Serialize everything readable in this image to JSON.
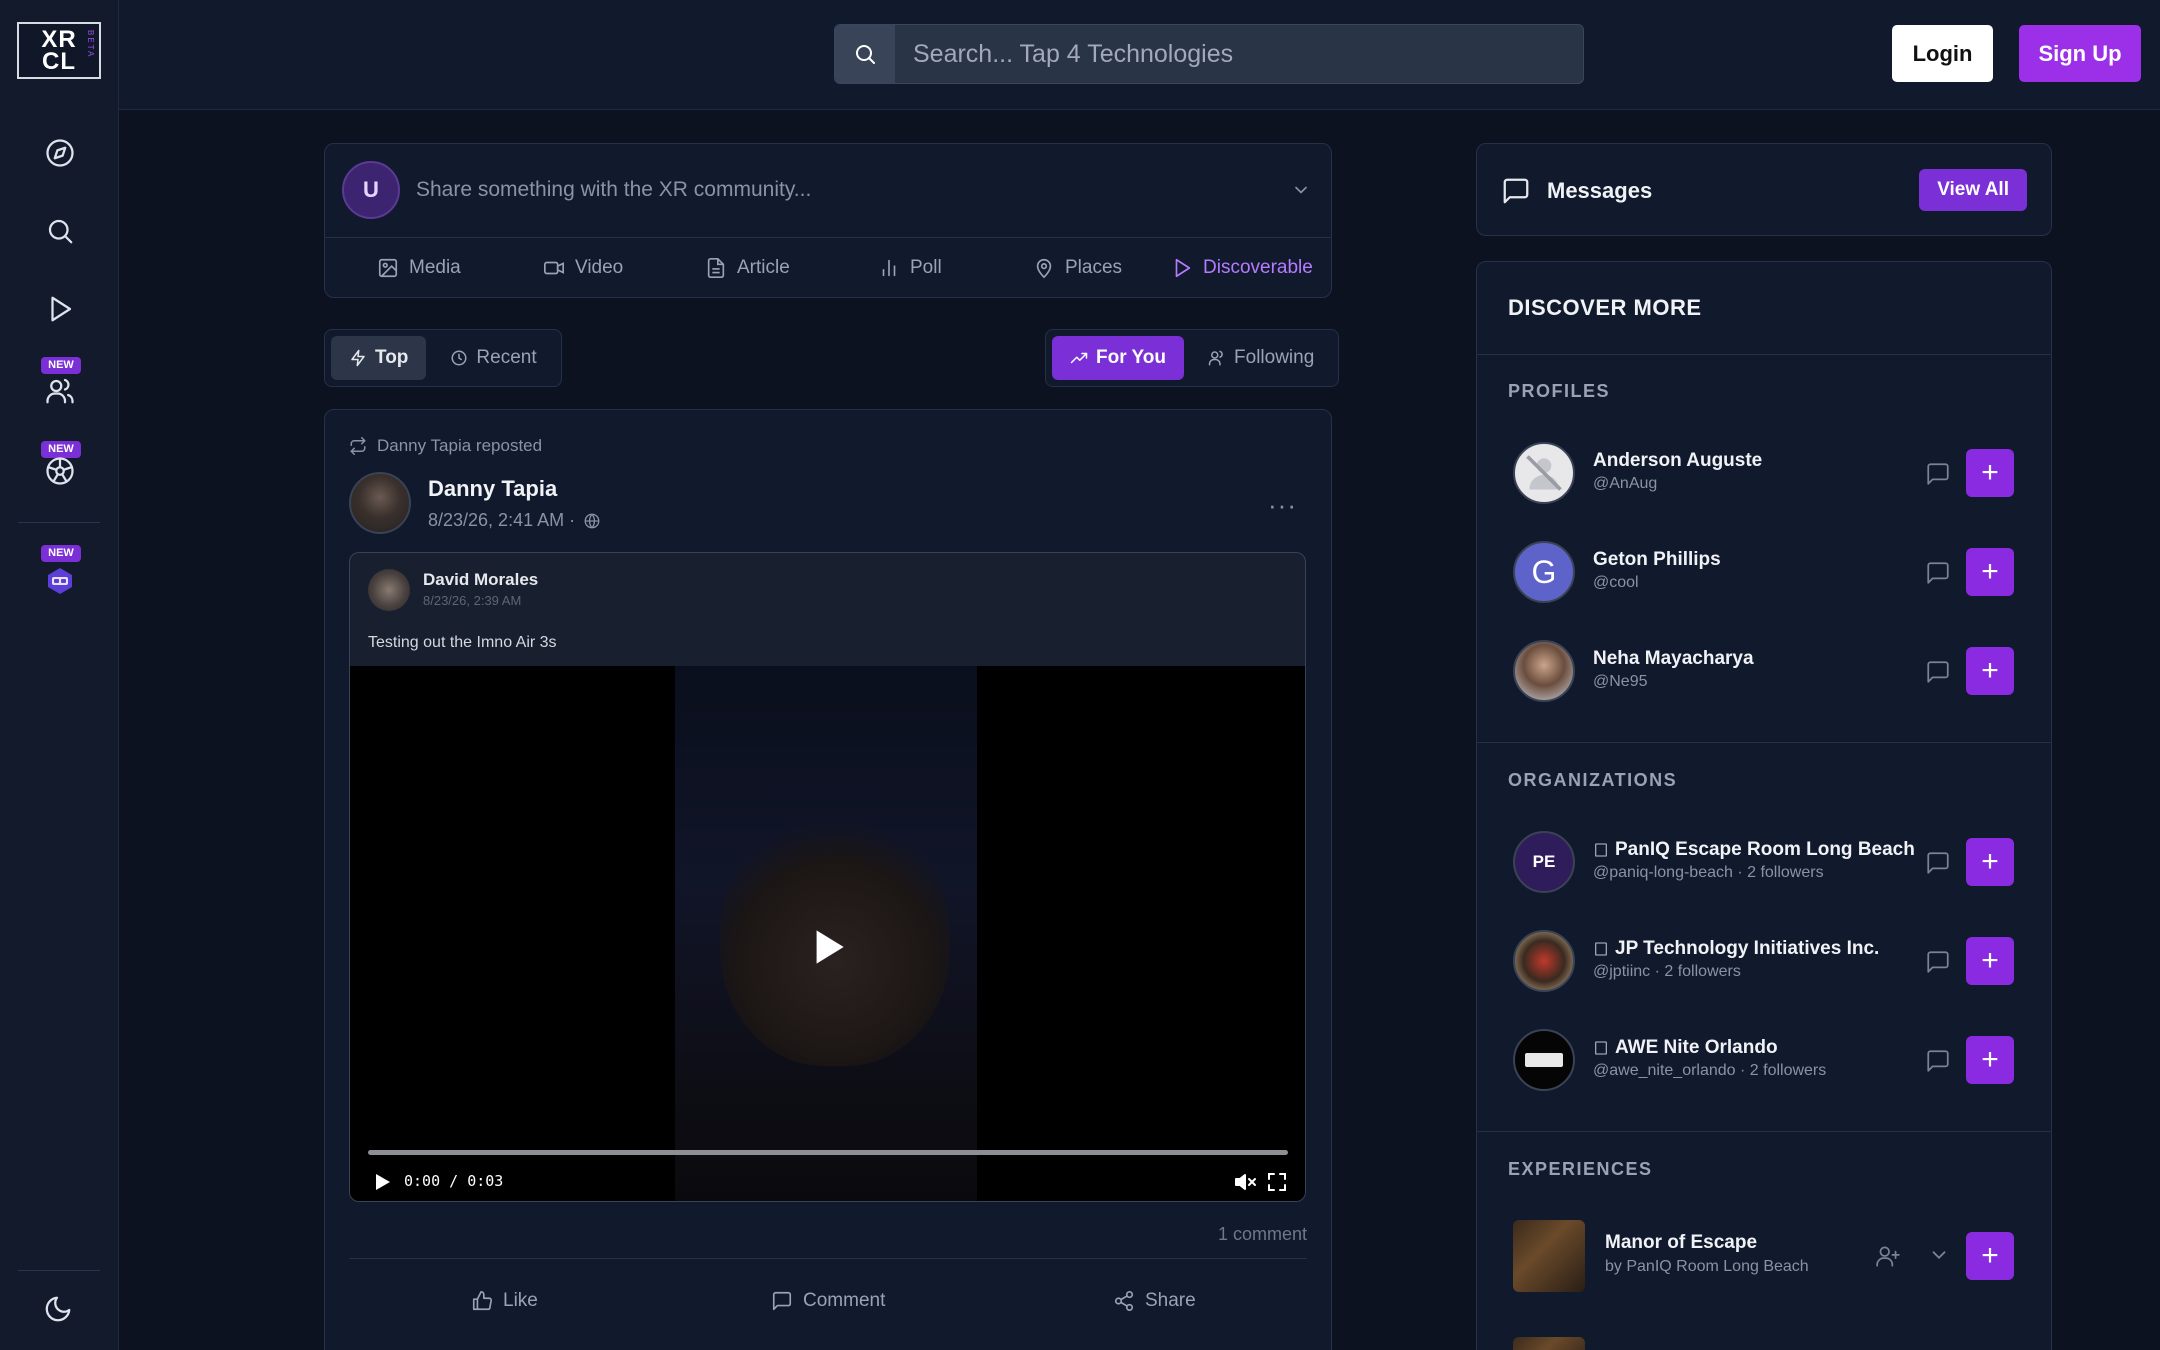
{
  "logo": {
    "text_line1": "XR",
    "text_line2": "CL",
    "beta": "BETA"
  },
  "sidebar": {
    "items": [
      {
        "icon": "compass-icon"
      },
      {
        "icon": "search-icon"
      },
      {
        "icon": "play-icon"
      },
      {
        "icon": "users-icon",
        "badge": "NEW"
      },
      {
        "icon": "globe-network-icon",
        "badge": "NEW"
      },
      {
        "icon": "vr-headset-icon",
        "badge": "NEW"
      }
    ],
    "bottom_icon": "moon-icon"
  },
  "topbar": {
    "search_placeholder": "Search... Tap 4 Technologies",
    "login_label": "Login",
    "signup_label": "Sign Up"
  },
  "composer": {
    "avatar_initial": "U",
    "placeholder": "Share something with the XR community...",
    "actions": [
      {
        "label": "Media",
        "icon": "image-icon"
      },
      {
        "label": "Video",
        "icon": "video-icon"
      },
      {
        "label": "Article",
        "icon": "document-icon"
      },
      {
        "label": "Poll",
        "icon": "bar-chart-icon"
      },
      {
        "label": "Places",
        "icon": "map-pin-icon"
      },
      {
        "label": "Discoverable",
        "icon": "play-outline-icon"
      }
    ]
  },
  "feed_tabs": {
    "sort": [
      {
        "label": "Top",
        "active": true
      },
      {
        "label": "Recent",
        "active": false
      }
    ],
    "scope": [
      {
        "label": "For You",
        "active": true
      },
      {
        "label": "Following",
        "active": false
      }
    ]
  },
  "post": {
    "repost_label": "Danny Tapia reposted",
    "author": "Danny Tapia",
    "date": "8/23/26, 2:41 AM ·",
    "more": "···",
    "inner": {
      "author": "David Morales",
      "date": "8/23/26, 2:39 AM",
      "text": "Testing out the Imno Air 3s",
      "video_time": "0:00 / 0:03",
      "video_progress": 0
    },
    "comment_count": "1 comment",
    "actions": [
      {
        "label": "Like"
      },
      {
        "label": "Comment"
      },
      {
        "label": "Share"
      }
    ]
  },
  "messages": {
    "title": "Messages",
    "view_all": "View All"
  },
  "discover": {
    "title": "DISCOVER MORE",
    "profiles_label": "PROFILES",
    "profiles": [
      {
        "name": "Anderson Auguste",
        "handle": "@AnAug",
        "avatar": "placeholder"
      },
      {
        "name": "Geton Phillips",
        "handle": "@cool",
        "avatar_initial": "G"
      },
      {
        "name": "Neha Mayacharya",
        "handle": "@Ne95",
        "avatar": "photo"
      }
    ],
    "organizations_label": "ORGANIZATIONS",
    "organizations": [
      {
        "name": "PanIQ Escape Room Long Beach",
        "sub": "@paniq-long-beach · 2 followers",
        "avatar_initial": "PE"
      },
      {
        "name": "JP Technology Initiatives Inc.",
        "sub": "@jptiinc · 2 followers"
      },
      {
        "name": "AWE Nite Orlando",
        "sub": "@awe_nite_orlando · 2 followers"
      }
    ],
    "experiences_label": "EXPERIENCES",
    "experiences": [
      {
        "name": "Manor of Escape",
        "sub": "by PanIQ Room Long Beach"
      }
    ]
  },
  "colors": {
    "accent": "#7b2fd6",
    "signup": "#9b30e8",
    "background": "#0d1220"
  }
}
